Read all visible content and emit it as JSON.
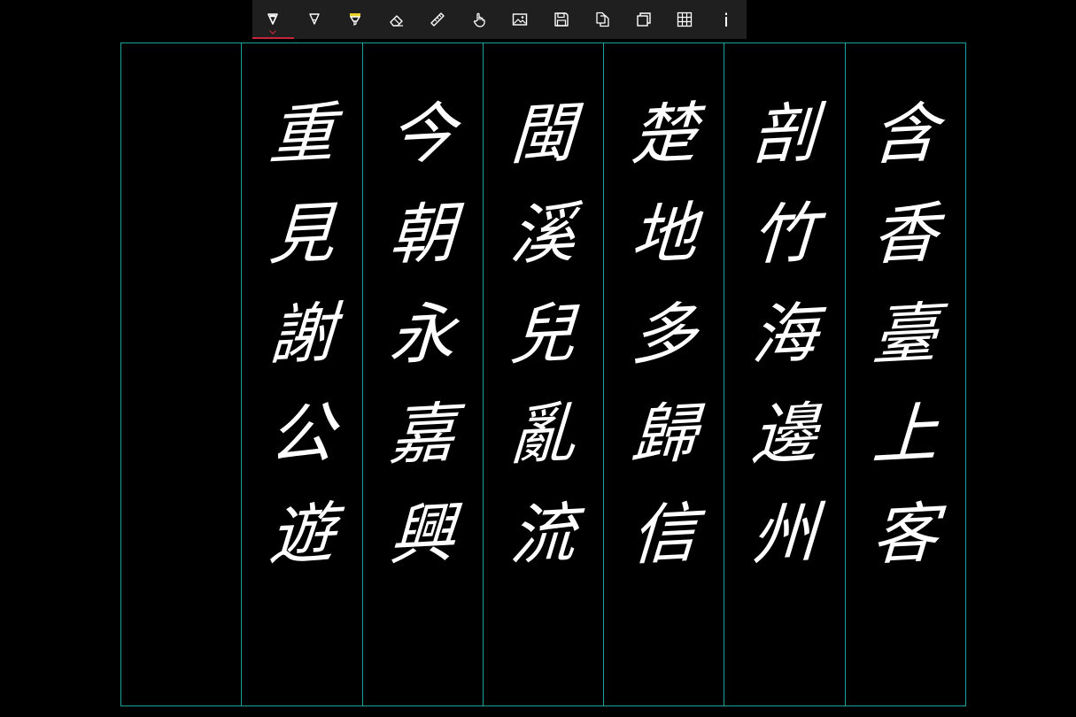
{
  "toolbar": {
    "active_bar_color": "#c8243c",
    "accent_color": "#19a39b",
    "tools": [
      {
        "name": "pen-tool",
        "icon": "pen-icon",
        "active": true
      },
      {
        "name": "pencil-tool",
        "icon": "pencil-icon",
        "active": false
      },
      {
        "name": "highlighter-tool",
        "icon": "highlighter-icon",
        "active": false,
        "color": "#e8d02a"
      },
      {
        "name": "eraser-tool",
        "icon": "eraser-icon",
        "active": false
      },
      {
        "name": "ruler-tool",
        "icon": "ruler-icon",
        "active": false
      },
      {
        "name": "touch-writing-tool",
        "icon": "hand-pointer-icon",
        "active": false
      },
      {
        "name": "insert-image-tool",
        "icon": "image-icon",
        "active": false
      },
      {
        "name": "save-tool",
        "icon": "save-icon",
        "active": false
      },
      {
        "name": "copy-tool",
        "icon": "copy-icon",
        "active": false
      },
      {
        "name": "duplicate-tool",
        "icon": "duplicate-icon",
        "active": false
      },
      {
        "name": "grid-tool",
        "icon": "grid-icon",
        "active": false
      },
      {
        "name": "info-tool",
        "icon": "info-icon",
        "active": false
      }
    ]
  },
  "paper": {
    "columns": [
      {
        "chars": []
      },
      {
        "chars": [
          "重",
          "見",
          "謝",
          "公",
          "遊"
        ]
      },
      {
        "chars": [
          "今",
          "朝",
          "永",
          "嘉",
          "興"
        ]
      },
      {
        "chars": [
          "閩",
          "溪",
          "兒",
          "亂",
          "流"
        ]
      },
      {
        "chars": [
          "楚",
          "地",
          "多",
          "歸",
          "信"
        ]
      },
      {
        "chars": [
          "剖",
          "竹",
          "海",
          "邊",
          "州"
        ]
      },
      {
        "chars": [
          "含",
          "香",
          "臺",
          "上",
          "客"
        ]
      }
    ]
  }
}
